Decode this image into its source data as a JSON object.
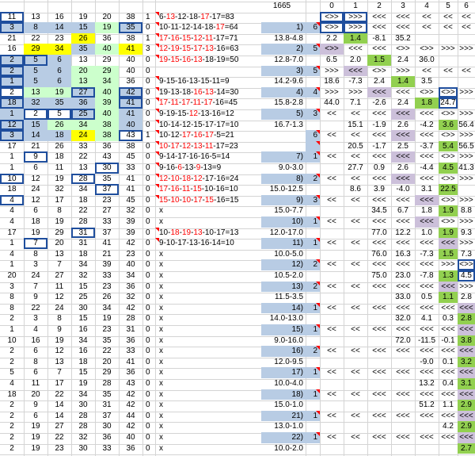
{
  "header_count": "1665",
  "col_headers": [
    "0",
    "1",
    "2",
    "3",
    "4",
    "5",
    "6"
  ],
  "rows": [
    {
      "n": [
        "11",
        "13",
        "16",
        "19",
        "20",
        "38"
      ],
      "c": "1",
      "eq": "6-13-12-18-17-17=83",
      "r": "",
      "k": "",
      "d": [
        "<>>",
        ">>>",
        "<<<",
        "<<<",
        "<<",
        "<<",
        "<<"
      ]
    },
    {
      "n": [
        "3",
        "8",
        "14",
        "15",
        "19",
        "35"
      ],
      "c": "0",
      "eq": "10-11-12-14-18-17=64",
      "r": "1)",
      "k": "6",
      "d": [
        "<>>",
        ">>>",
        "<<<",
        "<<<",
        "<<",
        "<<",
        "<<"
      ]
    },
    {
      "n": [
        "21",
        "22",
        "23",
        "26",
        "36",
        "38"
      ],
      "c": "1",
      "eq": "17-16-15-12-11-17=71",
      "r": "13.8-4.8",
      "k": "",
      "d": [
        "2.2",
        "1.4",
        "-8.1",
        "35.2",
        "",
        "",
        ""
      ]
    },
    {
      "n": [
        "16",
        "29",
        "34",
        "35",
        "40",
        "41"
      ],
      "c": "3",
      "eq": "12-19-15-17-13-16=63",
      "r": "2)",
      "k": "5",
      "d": [
        "<>>",
        "<<<",
        "<<<",
        "<>>",
        "<>>",
        ">>>",
        ">>>"
      ]
    },
    {
      "n": [
        "2",
        "5",
        "6",
        "13",
        "29",
        "40"
      ],
      "c": "0",
      "eq": "19-15-16-13-18-19=50",
      "r": "12.8-7.0",
      "k": "",
      "d": [
        "6.5",
        "2.0",
        "1.5",
        "2.4",
        "36.0",
        "",
        ""
      ]
    },
    {
      "n": [
        "2",
        "5",
        "6",
        "20",
        "29",
        "40"
      ],
      "c": "0",
      "eq": "",
      "r": "3)",
      "k": "5",
      "d": [
        ">>>",
        "<<<",
        "<>>",
        ">>>",
        "<<",
        "<<",
        "<<"
      ]
    },
    {
      "n": [
        "1",
        "5",
        "6",
        "13",
        "34",
        "36"
      ],
      "c": "0",
      "eq": "9-15-16-13-15-11=9",
      "r": "14.2-9.6",
      "k": "",
      "d": [
        "18.6",
        "-7.3",
        "2.4",
        "1.4",
        "3.5",
        "",
        ""
      ]
    },
    {
      "n": [
        "2",
        "13",
        "19",
        "27",
        "40",
        "42"
      ],
      "c": "0",
      "eq": "19-13-18-16-13-14=30",
      "r": "4)",
      "k": "4",
      "d": [
        ">>>",
        ">>>",
        "<<<",
        "<<<",
        "<>>",
        "<>>",
        ">>>"
      ]
    },
    {
      "n": [
        "18",
        "32",
        "35",
        "36",
        "39",
        "41"
      ],
      "c": "0",
      "eq": "17-11-17-11-17-16=45",
      "r": "15.8-2.8",
      "k": "",
      "d": [
        "44.0",
        "7.1",
        "-2.6",
        "2.4",
        "1.8",
        "24.7",
        ""
      ]
    },
    {
      "n": [
        "1",
        "2",
        "5",
        "25",
        "40",
        "41"
      ],
      "c": "0",
      "eq": "9-19-15-12-13-16=12",
      "r": "5)",
      "k": "3",
      "d": [
        "<<",
        "<<",
        "<<<",
        "<<<",
        "<<<",
        "<>>",
        ">>>"
      ]
    },
    {
      "n": [
        "12",
        "15",
        "26",
        "34",
        "38",
        "40"
      ],
      "c": "0",
      "eq": "10-14-12-15-17-17=10",
      "r": "16.7-1.3",
      "k": "",
      "d": [
        "",
        "15.1",
        "-1.9",
        "2.6",
        "-4.2",
        "3.6",
        "56.4"
      ]
    },
    {
      "n": [
        "3",
        "14",
        "18",
        "24",
        "38",
        "43"
      ],
      "c": "1",
      "eq": "10-12-17-16-17-5=21",
      "r": "",
      "k": "6",
      "d": [
        "<<",
        "<<",
        "<<<",
        "<<<",
        "<<<",
        "<>>",
        ">>>"
      ]
    },
    {
      "n": [
        "17",
        "21",
        "26",
        "33",
        "36",
        "38"
      ],
      "c": "0",
      "eq": "10-17-12-13-11-17=23",
      "r": "",
      "k": "",
      "d": [
        "",
        "20.5",
        "-1.7",
        "2.5",
        "-3.7",
        "5.4",
        "56.5"
      ]
    },
    {
      "n": [
        "1",
        "9",
        "18",
        "22",
        "43",
        "45"
      ],
      "c": "0",
      "eq": "9-14-17-16-16-5=14",
      "r": "7)",
      "k": "1",
      "d": [
        "<<",
        "<<",
        "<<<",
        "<<<",
        "<<<",
        "<>>",
        ">>>"
      ]
    },
    {
      "n": [
        "1",
        "6",
        "11",
        "13",
        "30",
        "33"
      ],
      "c": "0",
      "eq": "9-16-6-13-9-13=9",
      "r": "9.0-3.0",
      "k": "",
      "d": [
        "",
        "27.7",
        "0.9",
        "2.6",
        "-4.4",
        "4.5",
        "41.3"
      ]
    },
    {
      "n": [
        "10",
        "12",
        "19",
        "28",
        "35",
        "41"
      ],
      "c": "0",
      "eq": "12-10-18-12-17-16=24",
      "r": "8)",
      "k": "2",
      "d": [
        "<<",
        "<<",
        "<<<",
        "<<<",
        "<<<",
        "<>>",
        ">>>"
      ]
    },
    {
      "n": [
        "18",
        "24",
        "32",
        "34",
        "37",
        "41"
      ],
      "c": "0",
      "eq": "17-16-11-15-10-16=10",
      "r": "15.0-12.5",
      "k": "",
      "d": [
        "",
        "8.6",
        "3.9",
        "-4.0",
        "3.1",
        "22.5",
        ""
      ]
    },
    {
      "n": [
        "4",
        "12",
        "17",
        "18",
        "23",
        "45"
      ],
      "c": "0",
      "eq": "15-10-10-17-15-16=15",
      "r": "9)",
      "k": "3",
      "d": [
        "<<",
        "<<",
        "<<<",
        "<<<",
        "<<<",
        "<>>",
        ">>>"
      ]
    },
    {
      "n": [
        "4",
        "6",
        "8",
        "22",
        "27",
        "32"
      ],
      "c": "0",
      "eq": "x",
      "r": "15.0-7.7",
      "k": "",
      "d": [
        "",
        "",
        "34.5",
        "6.7",
        "1.8",
        "1.9",
        "8.8"
      ]
    },
    {
      "n": [
        "4",
        "18",
        "19",
        "28",
        "33",
        "39"
      ],
      "c": "0",
      "eq": "x",
      "r": "10)",
      "k": "1",
      "d": [
        "<<",
        "<<",
        "<<<",
        "<<<",
        "<<<",
        "<>>",
        ">>>"
      ]
    },
    {
      "n": [
        "17",
        "19",
        "29",
        "31",
        "37",
        "39"
      ],
      "c": "0",
      "eq": "10-18-19-13-10-17=13",
      "r": "12.0-17.0",
      "k": "",
      "d": [
        "",
        "",
        "77.0",
        "12.2",
        "1.0",
        "1.9",
        "9.3"
      ]
    },
    {
      "n": [
        "1",
        "7",
        "20",
        "31",
        "41",
        "42"
      ],
      "c": "0",
      "eq": "9-10-17-13-16-14=10",
      "r": "11)",
      "k": "1",
      "d": [
        "<<",
        "<<",
        "<<<",
        "<<<",
        "<<<",
        "<<<",
        ">>>"
      ]
    },
    {
      "n": [
        "4",
        "8",
        "13",
        "18",
        "21",
        "23"
      ],
      "c": "0",
      "eq": "x",
      "r": "10.0-5.0",
      "k": "",
      "d": [
        "",
        "",
        "76.0",
        "16.3",
        "-7.3",
        "1.5",
        "7.3"
      ]
    },
    {
      "n": [
        "1",
        "3",
        "7",
        "34",
        "39",
        "40"
      ],
      "c": "0",
      "eq": "x",
      "r": "12)",
      "k": "2",
      "d": [
        "<<",
        "<<",
        "<<<",
        "<<<",
        "<<<",
        ">>>",
        "<>>"
      ]
    },
    {
      "n": [
        "20",
        "24",
        "27",
        "32",
        "33",
        "34"
      ],
      "c": "0",
      "eq": "x",
      "r": "10.5-2.0",
      "k": "",
      "d": [
        "",
        "",
        "75.0",
        "23.0",
        "-7.8",
        "1.3",
        "4.5"
      ]
    },
    {
      "n": [
        "3",
        "7",
        "11",
        "15",
        "23",
        "36"
      ],
      "c": "0",
      "eq": "x",
      "r": "13)",
      "k": "2",
      "d": [
        "<<",
        "<<",
        "<<<",
        "<<<",
        "<<<",
        "<<<",
        ">>>"
      ]
    },
    {
      "n": [
        "8",
        "9",
        "12",
        "25",
        "26",
        "32"
      ],
      "c": "0",
      "eq": "x",
      "r": "11.5-3.5",
      "k": "",
      "d": [
        "",
        "",
        "",
        "33.0",
        "0.5",
        "1.1",
        "2.8"
      ]
    },
    {
      "n": [
        "8",
        "22",
        "24",
        "30",
        "34",
        "42"
      ],
      "c": "0",
      "eq": "x",
      "r": "14)",
      "k": "1",
      "d": [
        "<<",
        "<<",
        "<<<",
        "<<<",
        "<<<",
        "<<<",
        "<<<"
      ]
    },
    {
      "n": [
        "2",
        "3",
        "8",
        "15",
        "19",
        "28"
      ],
      "c": "0",
      "eq": "x",
      "r": "14.0-13.0",
      "k": "",
      "d": [
        "",
        "",
        "",
        "32.0",
        "4.1",
        "0.3",
        "2.8"
      ]
    },
    {
      "n": [
        "1",
        "4",
        "9",
        "16",
        "23",
        "31"
      ],
      "c": "0",
      "eq": "x",
      "r": "15)",
      "k": "1",
      "d": [
        "<<",
        "<<",
        "<<<",
        "<<<",
        "<<<",
        "<<<",
        "<<<"
      ]
    },
    {
      "n": [
        "10",
        "16",
        "19",
        "34",
        "35",
        "36"
      ],
      "c": "0",
      "eq": "x",
      "r": "9.0-16.0",
      "k": "",
      "d": [
        "",
        "",
        "",
        "72.0",
        "-11.5",
        "-0.1",
        "3.8"
      ]
    },
    {
      "n": [
        "2",
        "6",
        "12",
        "16",
        "22",
        "33"
      ],
      "c": "0",
      "eq": "x",
      "r": "16)",
      "k": "2",
      "d": [
        "<<",
        "<<",
        "<<<",
        "<<<",
        "<<<",
        "<<<",
        "<<<"
      ]
    },
    {
      "n": [
        "2",
        "8",
        "13",
        "18",
        "20",
        "41"
      ],
      "c": "0",
      "eq": "x",
      "r": "12.0-9.5",
      "k": "",
      "d": [
        "",
        "",
        "",
        "",
        "-9.0",
        "0.1",
        "3.2"
      ]
    },
    {
      "n": [
        "5",
        "6",
        "7",
        "15",
        "29",
        "36"
      ],
      "c": "0",
      "eq": "x",
      "r": "17)",
      "k": "1",
      "d": [
        "<<",
        "<<",
        "<<<",
        "<<<",
        "<<<",
        "<<<",
        "<<<"
      ]
    },
    {
      "n": [
        "4",
        "11",
        "17",
        "19",
        "28",
        "43"
      ],
      "c": "0",
      "eq": "x",
      "r": "10.0-4.0",
      "k": "",
      "d": [
        "",
        "",
        "",
        "",
        "13.2",
        "0.4",
        "3.1"
      ]
    },
    {
      "n": [
        "18",
        "20",
        "22",
        "34",
        "35",
        "42"
      ],
      "c": "0",
      "eq": "x",
      "r": "18)",
      "k": "1",
      "d": [
        "<<",
        "<<",
        "<<<",
        "<<<",
        "<<<",
        "<<<",
        "<<<"
      ]
    },
    {
      "n": [
        "2",
        "9",
        "14",
        "30",
        "31",
        "42"
      ],
      "c": "0",
      "eq": "x",
      "r": "15.0-1.0",
      "k": "",
      "d": [
        "",
        "",
        "",
        "",
        "51.2",
        "1.1",
        "2.9"
      ]
    },
    {
      "n": [
        "2",
        "6",
        "14",
        "28",
        "37",
        "44"
      ],
      "c": "0",
      "eq": "x",
      "r": "21)",
      "k": "1",
      "d": [
        "<<",
        "<<",
        "<<<",
        "<<<",
        "<<<",
        "<<<",
        "<<<"
      ]
    },
    {
      "n": [
        "2",
        "19",
        "27",
        "28",
        "30",
        "42"
      ],
      "c": "0",
      "eq": "x",
      "r": "13.0-1.0",
      "k": "",
      "d": [
        "",
        "",
        "",
        "",
        "",
        "4.2",
        "2.9"
      ]
    },
    {
      "n": [
        "2",
        "19",
        "22",
        "32",
        "36",
        "40"
      ],
      "c": "0",
      "eq": "x",
      "r": "22)",
      "k": "1",
      "d": [
        "<<",
        "<<",
        "<<<",
        "<<<",
        "<<<",
        "<<<",
        "<<<"
      ]
    },
    {
      "n": [
        "2",
        "19",
        "23",
        "30",
        "33",
        "36"
      ],
      "c": "0",
      "eq": "x",
      "r": "10.0-2.0",
      "k": "",
      "d": [
        "",
        "",
        "",
        "",
        "",
        "",
        "2.7"
      ]
    }
  ],
  "colors": {
    "blue": "#b8cce4",
    "light_green": "#ccffcc",
    "yellow": "#ffff00",
    "green": "#92d050",
    "lavender": "#ccc0da",
    "border": "#1f4e9d",
    "red": "#ff0000"
  }
}
